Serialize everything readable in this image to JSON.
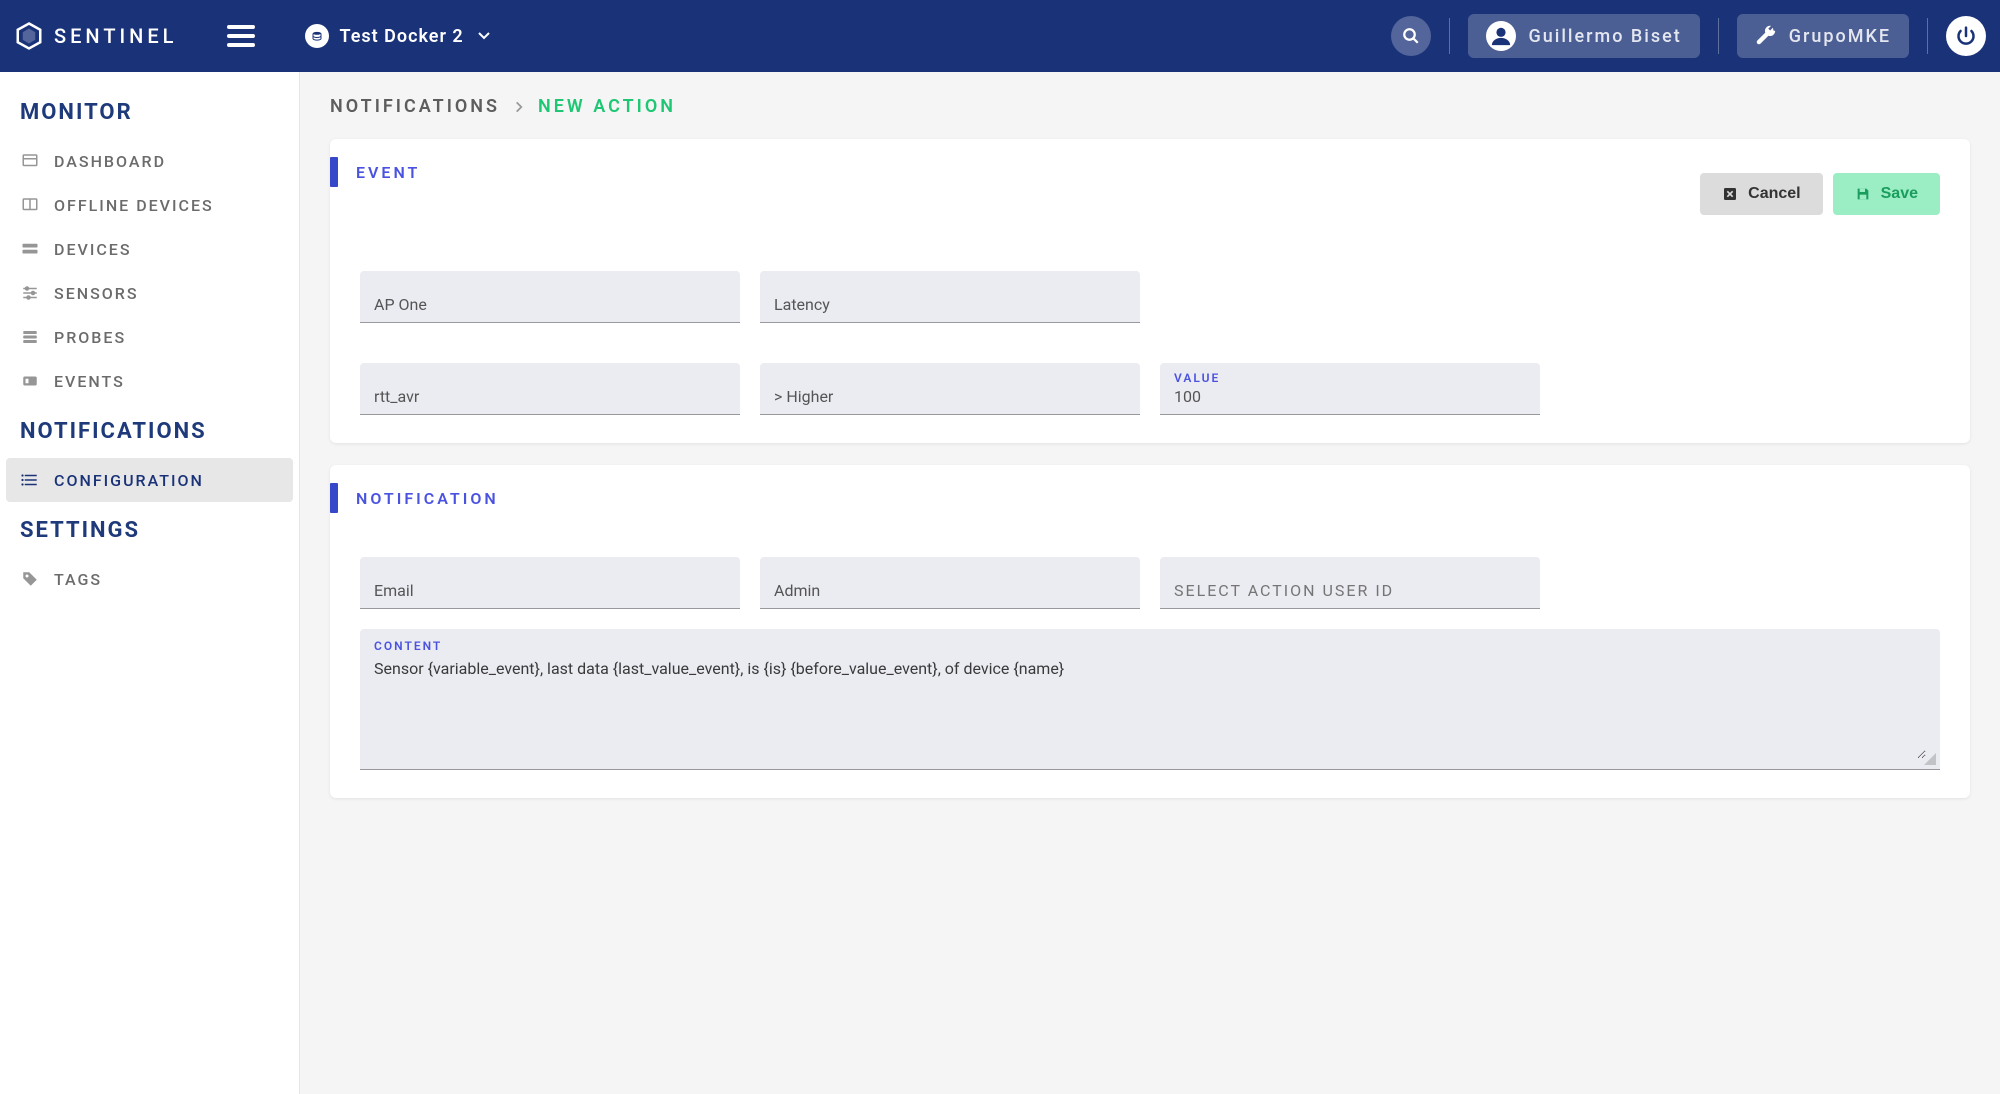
{
  "header": {
    "brand": "SENTINEL",
    "environment": "Test Docker 2",
    "user_name": "Guillermo Biset",
    "group_name": "GrupoMKE"
  },
  "sidebar": {
    "section_monitor": "MONITOR",
    "section_notifications": "NOTIFICATIONS",
    "section_settings": "SETTINGS",
    "items_monitor": [
      {
        "label": "DASHBOARD"
      },
      {
        "label": "OFFLINE DEVICES"
      },
      {
        "label": "DEVICES"
      },
      {
        "label": "SENSORS"
      },
      {
        "label": "PROBES"
      },
      {
        "label": "EVENTS"
      }
    ],
    "items_notifications": [
      {
        "label": "CONFIGURATION"
      }
    ],
    "items_settings": [
      {
        "label": "TAGS"
      }
    ]
  },
  "breadcrumb": {
    "root": "NOTIFICATIONS",
    "current": "NEW ACTION"
  },
  "event_card": {
    "title": "EVENT",
    "cancel_label": "Cancel",
    "save_label": "Save",
    "device": "AP One",
    "sensor": "Latency",
    "variable": "rtt_avr",
    "operator": "> Higher",
    "value_label": "VALUE",
    "value": "100"
  },
  "notification_card": {
    "title": "NOTIFICATION",
    "action_type": "Email",
    "user": "Admin",
    "user_id_placeholder": "SELECT ACTION USER ID",
    "content_label": "CONTENT",
    "content_value": "Sensor {variable_event}, last data {last_value_event}, is {is} {before_value_event}, of device {name}"
  }
}
